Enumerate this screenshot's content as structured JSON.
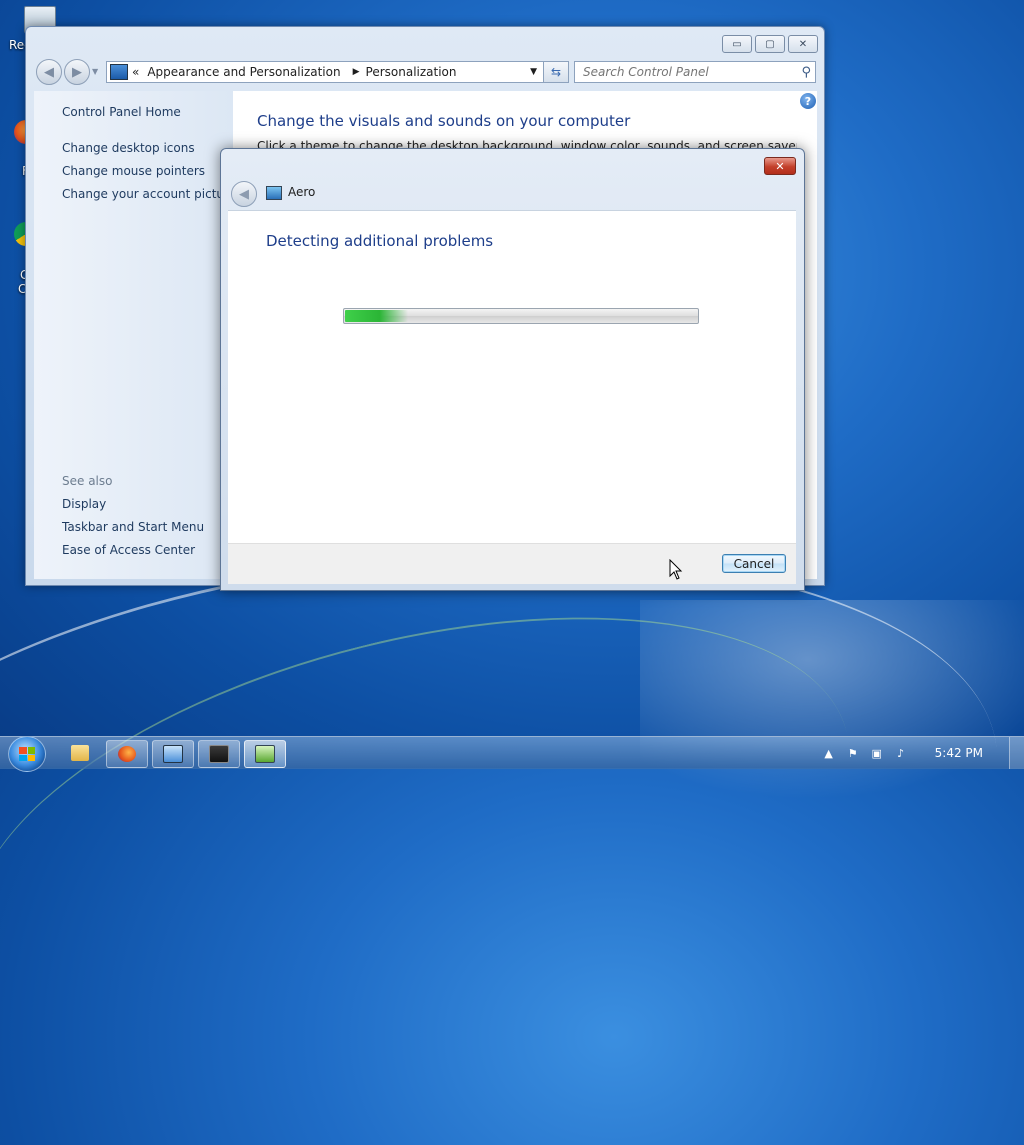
{
  "desktop": {
    "recycle_label": "Rec",
    "firefox_label": "F",
    "chrome_label_1": "G",
    "chrome_label_2": "C"
  },
  "control_panel": {
    "breadcrumb": {
      "overflow": "«",
      "items": [
        "Appearance and Personalization",
        "Personalization"
      ]
    },
    "search_placeholder": "Search Control Panel",
    "sidebar": {
      "home": "Control Panel Home",
      "links": [
        "Change desktop icons",
        "Change mouse pointers",
        "Change your account picture"
      ],
      "see_also_heading": "See also",
      "see_also": [
        "Display",
        "Taskbar and Start Menu",
        "Ease of Access Center"
      ]
    },
    "main": {
      "title": "Change the visuals and sounds on your computer",
      "description": "Click a theme to change the desktop background, window color, sounds, and screen saver all at once."
    },
    "caption_buttons": {
      "minimize": "▭",
      "maximize": "▢",
      "close": "✕"
    }
  },
  "dialog": {
    "title": "Aero",
    "heading": "Detecting additional problems",
    "progress_fraction": 0.18,
    "cancel_label": "Cancel",
    "close_glyph": "✕"
  },
  "taskbar": {
    "clock": "5:42 PM",
    "tray_expand": "▲"
  },
  "colors": {
    "link": "#1e3a5f",
    "heading_blue": "#1e3e8a",
    "progress_green": "#2bb536"
  }
}
